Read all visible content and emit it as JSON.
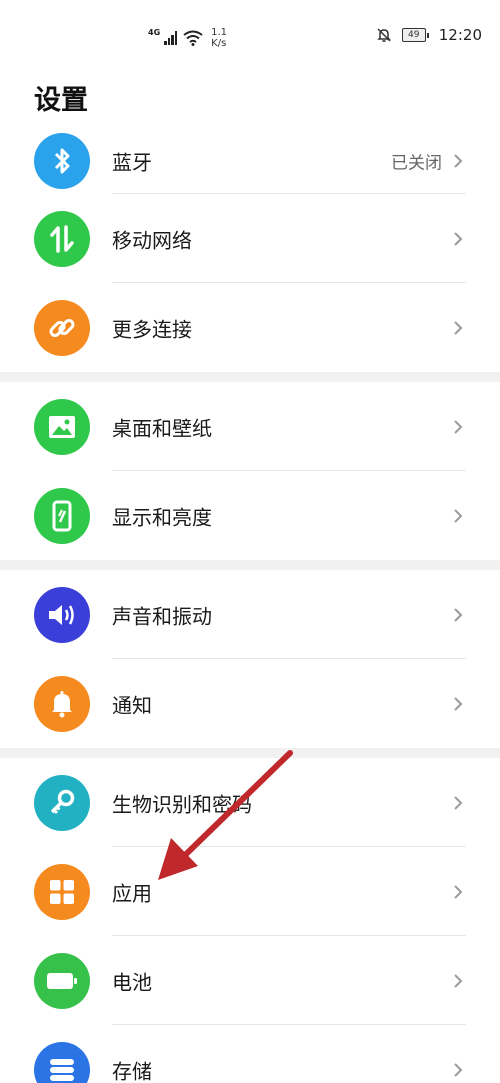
{
  "status_bar": {
    "network": "4G",
    "speed_value": "1.1",
    "speed_unit": "K/s",
    "battery": "49",
    "time": "12:20"
  },
  "page": {
    "title": "设置"
  },
  "sections": [
    {
      "items": [
        {
          "label": "蓝牙",
          "value": "已关闭",
          "icon": "bluetooth-icon",
          "color": "#2aa3ec"
        },
        {
          "label": "移动网络",
          "icon": "mobile-data-icon",
          "color": "#2fc84a"
        },
        {
          "label": "更多连接",
          "icon": "link-icon",
          "color": "#f58a1f"
        }
      ]
    },
    {
      "items": [
        {
          "label": "桌面和壁纸",
          "icon": "wallpaper-icon",
          "color": "#2fc84a"
        },
        {
          "label": "显示和亮度",
          "icon": "display-icon",
          "color": "#2fc84a"
        }
      ]
    },
    {
      "items": [
        {
          "label": "声音和振动",
          "icon": "speaker-icon",
          "color": "#3b3fd9"
        },
        {
          "label": "通知",
          "icon": "bell-icon",
          "color": "#f58a1f"
        }
      ]
    },
    {
      "items": [
        {
          "label": "生物识别和密码",
          "icon": "key-icon",
          "color": "#22b0c3"
        },
        {
          "label": "应用",
          "icon": "apps-icon",
          "color": "#f58a1f"
        },
        {
          "label": "电池",
          "icon": "battery-icon",
          "color": "#36c24a"
        },
        {
          "label": "存储",
          "icon": "storage-icon",
          "color": "#2a74e6"
        }
      ]
    }
  ],
  "annotation": {
    "color": "#c0282b",
    "points_to": "应用"
  }
}
